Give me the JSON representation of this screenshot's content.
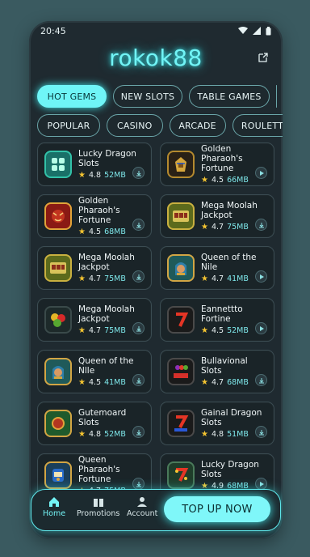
{
  "status": {
    "time": "20:45"
  },
  "app": {
    "title": "rokok88"
  },
  "chips_row1": [
    "HOT GEMS",
    "NEW SLOTS",
    "TABLE GAMES"
  ],
  "chips_row2": [
    "POPULAR",
    "CASINO",
    "ARCADE",
    "ROULETTE"
  ],
  "games": [
    {
      "name": "Lucky Dragon Slots",
      "rating": "4.8",
      "size": "52MB",
      "action": "download",
      "icon": "jade-emblem-icon"
    },
    {
      "name": "Golden Pharaoh's Fortune",
      "rating": "4.5",
      "size": "66MB",
      "action": "play",
      "icon": "pharaoh-icon"
    },
    {
      "name": "Golden Pharaoh's Fortune",
      "rating": "4.5",
      "size": "68MB",
      "action": "download",
      "icon": "dragon-mask-icon"
    },
    {
      "name": "Mega Moolah Jackpot",
      "rating": "4.7",
      "size": "75MB",
      "action": "download",
      "icon": "jackpot-icon"
    },
    {
      "name": "Mega Moolah Jackpot",
      "rating": "4.7",
      "size": "75MB",
      "action": "download",
      "icon": "jackpot-icon"
    },
    {
      "name": "Queen of the Nile",
      "rating": "4.7",
      "size": "41MB",
      "action": "play",
      "icon": "queen-icon"
    },
    {
      "name": "Mega Moolah Jackpot",
      "rating": "4.7",
      "size": "75MB",
      "action": "download",
      "icon": "fruit-icon"
    },
    {
      "name": "Eannettto Fortine",
      "rating": "4.5",
      "size": "52MB",
      "action": "play",
      "icon": "seven-icon"
    },
    {
      "name": "Queen of the Nlle",
      "rating": "4.5",
      "size": "41MB",
      "action": "download",
      "icon": "queen-icon"
    },
    {
      "name": "Bullavional Slots",
      "rating": "4.7",
      "size": "68MB",
      "action": "download",
      "icon": "grapes-slots-icon"
    },
    {
      "name": "Gutemoard Slots",
      "rating": "4.8",
      "size": "52MB",
      "action": "download",
      "icon": "coin-79-icon"
    },
    {
      "name": "Gainal Dragon Slots",
      "rating": "4.8",
      "size": "51MB",
      "action": "download",
      "icon": "seven-slots-icon"
    },
    {
      "name": "Queen Pharaoh's Fortune",
      "rating": "4.7",
      "size": "75MB",
      "action": "download",
      "icon": "jackpot-machine-icon"
    },
    {
      "name": "Lucky Dragon Slots",
      "rating": "4.9",
      "size": "68MB",
      "action": "play",
      "icon": "seven-slots-icon"
    }
  ],
  "nav": {
    "home": "Home",
    "promotions": "Promotions",
    "account": "Account",
    "cta": "TOP UP NOW"
  },
  "colors": {
    "accent": "#6ff5f7",
    "background": "#1f2a30",
    "star": "#f4c431"
  }
}
